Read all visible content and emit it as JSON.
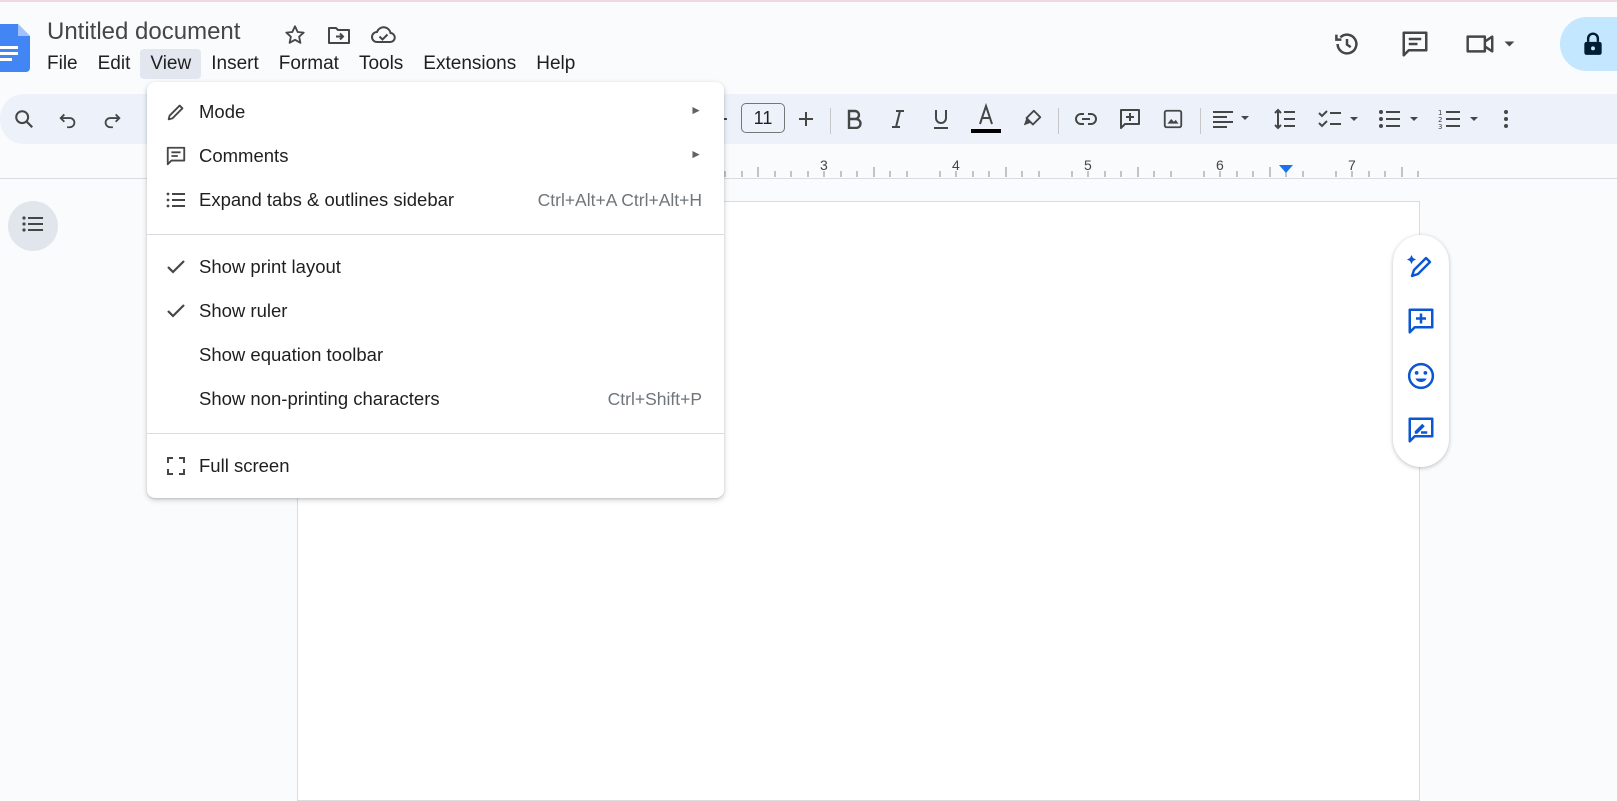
{
  "document": {
    "title": "Untitled document"
  },
  "menubar": {
    "items": [
      "File",
      "Edit",
      "View",
      "Insert",
      "Format",
      "Tools",
      "Extensions",
      "Help"
    ]
  },
  "toolbar": {
    "font_size": "11"
  },
  "ruler": {
    "numbers": [
      "3",
      "4",
      "5",
      "6",
      "7"
    ]
  },
  "view_menu": {
    "mode": "Mode",
    "comments": "Comments",
    "expand_sidebar": "Expand tabs & outlines sidebar",
    "expand_sidebar_shortcut": "Ctrl+Alt+A Ctrl+Alt+H",
    "show_print_layout": "Show print layout",
    "show_ruler": "Show ruler",
    "show_equation_toolbar": "Show equation toolbar",
    "show_nonprinting": "Show non-printing characters",
    "show_nonprinting_shortcut": "Ctrl+Shift+P",
    "full_screen": "Full screen",
    "submenu_arrow": "►"
  },
  "colors": {
    "accent": "#1a73e8",
    "share_bg": "#c2e7ff",
    "toolbar_bg": "#edf2fa",
    "menu_active_bg": "#e2e7ef"
  }
}
